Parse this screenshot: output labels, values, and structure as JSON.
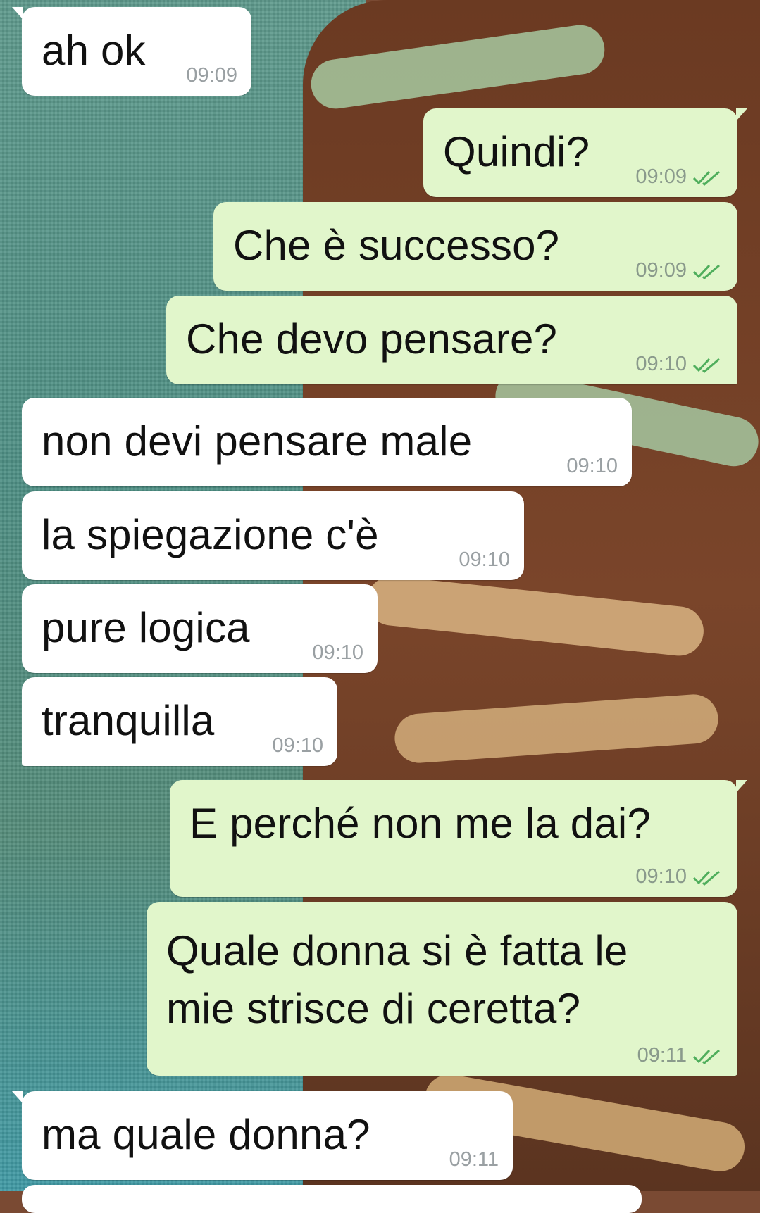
{
  "chat": {
    "messages": [
      {
        "direction": "in",
        "text": "ah ok",
        "time": "09:09"
      },
      {
        "direction": "out",
        "text": "Quindi?",
        "time": "09:09",
        "status": "read-double-check"
      },
      {
        "direction": "out",
        "text": "Che è successo?",
        "time": "09:09",
        "status": "read-double-check"
      },
      {
        "direction": "out",
        "text": "Che devo pensare?",
        "time": "09:10",
        "status": "read-double-check"
      },
      {
        "direction": "in",
        "text": "non devi pensare male",
        "time": "09:10"
      },
      {
        "direction": "in",
        "text": "la spiegazione c'è",
        "time": "09:10"
      },
      {
        "direction": "in",
        "text": "pure logica",
        "time": "09:10"
      },
      {
        "direction": "in",
        "text": "tranquilla",
        "time": "09:10"
      },
      {
        "direction": "out",
        "text": "E perché non me la dai?",
        "time": "09:10",
        "status": "read-double-check"
      },
      {
        "direction": "out",
        "text_line1": "Quale donna si è fatta le",
        "text_line2": "mie strisce di ceretta?",
        "time": "09:11",
        "status": "read-double-check"
      },
      {
        "direction": "in",
        "text": "ma quale donna?",
        "time": "09:11"
      }
    ]
  },
  "colors": {
    "incoming_bubble": "#ffffff",
    "outgoing_bubble": "#e1f6cb",
    "read_ticks": "#4fae5c",
    "timestamp": "#9aa0a3"
  },
  "icons": {
    "read_status": "double-check-icon"
  }
}
